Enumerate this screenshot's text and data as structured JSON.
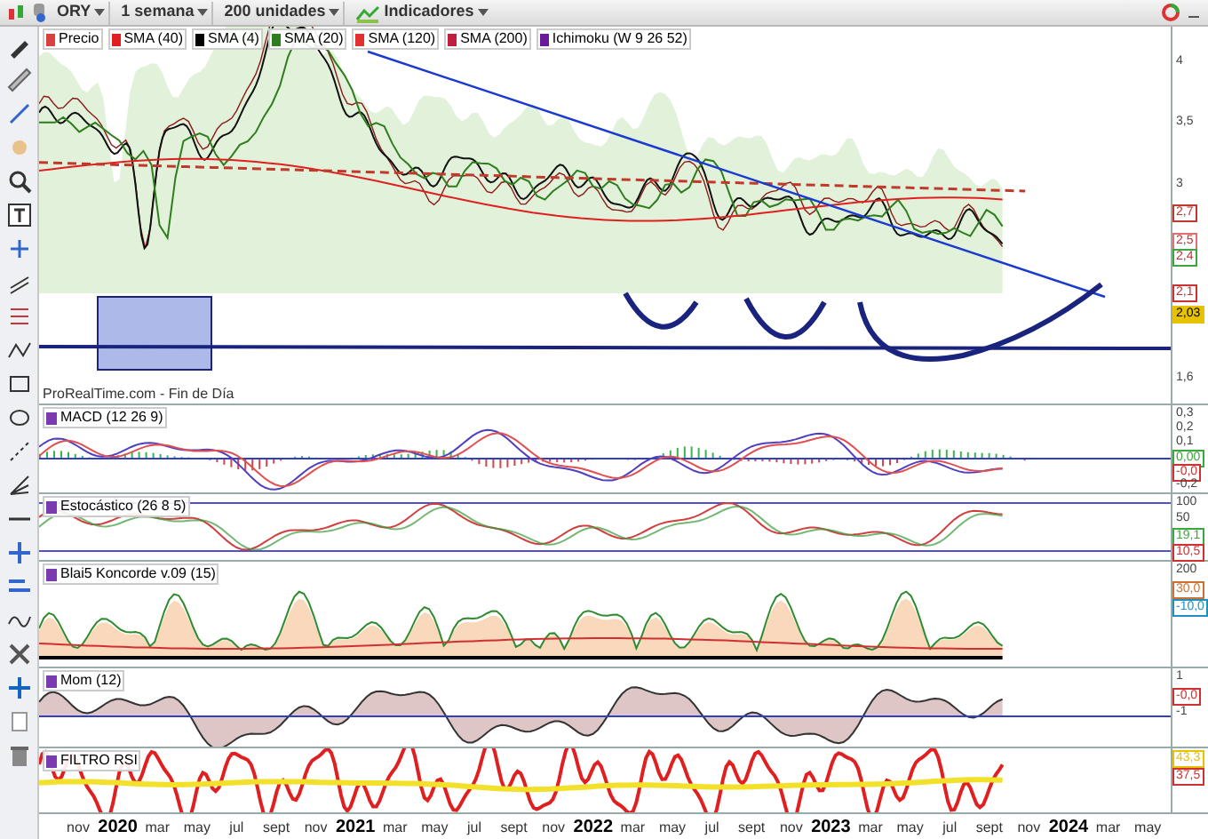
{
  "toolbar": {
    "ticker": "ORY",
    "timeframe": "1 semana",
    "units": "200 unidades",
    "indicators": "Indicadores"
  },
  "price_panel": {
    "legend": [
      {
        "label": "Precio",
        "color": "#d94040"
      },
      {
        "label": "SMA (40)",
        "color": "#e02020"
      },
      {
        "label": "SMA (4)",
        "color": "#000000"
      },
      {
        "label": "SMA (20)",
        "color": "#2e7d1e"
      },
      {
        "label": "SMA (120)",
        "color": "#e03030"
      },
      {
        "label": "SMA (200)",
        "color": "#c02040"
      },
      {
        "label": "Ichimoku (W 9 26 52)",
        "color": "#6a1b9a"
      }
    ],
    "axis_labels": [
      "4",
      "3,5",
      "3",
      "1,6"
    ],
    "tags": [
      {
        "text": "2,7",
        "color": "#c0392b"
      },
      {
        "text": "2,5",
        "color": "#e07070"
      },
      {
        "text": "2,4",
        "color": "#3aa83a"
      },
      {
        "text": "2,1",
        "color": "#d03030"
      },
      {
        "text": "2,03",
        "color": "#e6c200"
      }
    ],
    "source": "ProRealTime.com - Fin de Día"
  },
  "panels": [
    {
      "kind": "macd",
      "title": "MACD (12 26 9)",
      "axis": [
        {
          "kind": "label",
          "text": "0,3"
        },
        {
          "kind": "label",
          "text": "0,2"
        },
        {
          "kind": "label",
          "text": "0,1"
        },
        {
          "kind": "tag",
          "text": "0,00",
          "color": "#3aa83a"
        },
        {
          "kind": "tag",
          "text": "-0,0",
          "color": "#d03030"
        },
        {
          "kind": "label",
          "text": "-0,2"
        }
      ]
    },
    {
      "kind": "stochastic",
      "title": "Estocástico (26 8 5)",
      "axis": [
        {
          "kind": "label",
          "text": "100"
        },
        {
          "kind": "label",
          "text": "50"
        },
        {
          "kind": "tag",
          "text": "19,1",
          "color": "#3aa83a"
        },
        {
          "kind": "tag",
          "text": "10,5",
          "color": "#d03030"
        }
      ]
    },
    {
      "kind": "koncorde",
      "title": "Blai5 Koncorde v.09 (15)",
      "axis": [
        {
          "kind": "label",
          "text": "200"
        },
        {
          "kind": "tag",
          "text": "30,0",
          "color": "#d07030"
        },
        {
          "kind": "tag",
          "text": "-10,0",
          "color": "#2090c0"
        }
      ]
    },
    {
      "kind": "momentum",
      "title": "Mom (12)",
      "axis": [
        {
          "kind": "label",
          "text": "1"
        },
        {
          "kind": "tag",
          "text": "-0,0",
          "color": "#d03030"
        },
        {
          "kind": "label",
          "text": "-1"
        }
      ]
    },
    {
      "kind": "rsi",
      "title": "FILTRO RSI",
      "axis": [
        {
          "kind": "tag",
          "text": "43,3",
          "color": "#e6c200"
        },
        {
          "kind": "tag",
          "text": "37,5",
          "color": "#d03030"
        }
      ]
    }
  ],
  "x_axis": [
    {
      "label": "nov",
      "kind": "month"
    },
    {
      "label": "2020",
      "kind": "year"
    },
    {
      "label": "mar",
      "kind": "month"
    },
    {
      "label": "may",
      "kind": "month"
    },
    {
      "label": "jul",
      "kind": "month"
    },
    {
      "label": "sept",
      "kind": "month"
    },
    {
      "label": "nov",
      "kind": "month"
    },
    {
      "label": "2021",
      "kind": "year"
    },
    {
      "label": "mar",
      "kind": "month"
    },
    {
      "label": "may",
      "kind": "month"
    },
    {
      "label": "jul",
      "kind": "month"
    },
    {
      "label": "sept",
      "kind": "month"
    },
    {
      "label": "nov",
      "kind": "month"
    },
    {
      "label": "2022",
      "kind": "year"
    },
    {
      "label": "mar",
      "kind": "month"
    },
    {
      "label": "may",
      "kind": "month"
    },
    {
      "label": "jul",
      "kind": "month"
    },
    {
      "label": "sept",
      "kind": "month"
    },
    {
      "label": "nov",
      "kind": "month"
    },
    {
      "label": "2023",
      "kind": "year"
    },
    {
      "label": "mar",
      "kind": "month"
    },
    {
      "label": "may",
      "kind": "month"
    },
    {
      "label": "jul",
      "kind": "month"
    },
    {
      "label": "sept",
      "kind": "month"
    },
    {
      "label": "nov",
      "kind": "month"
    },
    {
      "label": "2024",
      "kind": "year"
    },
    {
      "label": "mar",
      "kind": "month"
    },
    {
      "label": "may",
      "kind": "month"
    }
  ]
}
